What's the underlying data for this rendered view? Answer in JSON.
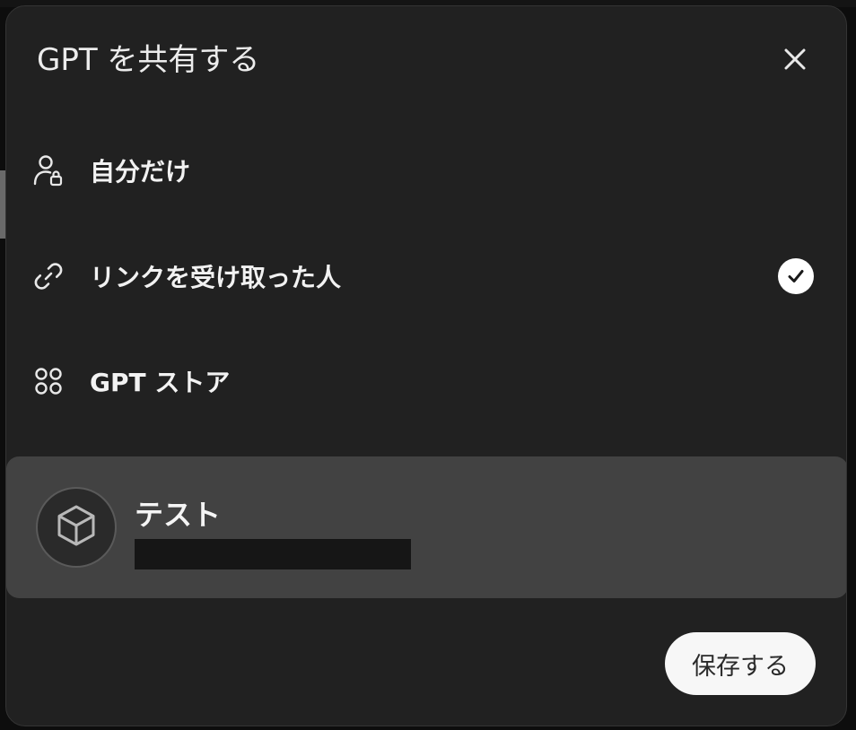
{
  "dialog": {
    "title": "GPT を共有する",
    "close_icon": "close-icon"
  },
  "share_options": [
    {
      "label": "自分だけ",
      "icon": "person-lock-icon",
      "selected": false
    },
    {
      "label": "リンクを受け取った人",
      "icon": "link-icon",
      "selected": true
    },
    {
      "label": "GPT ストア",
      "icon": "grid-icon",
      "selected": false
    }
  ],
  "gpt": {
    "name": "テスト",
    "icon": "cube-icon",
    "description_redacted": true
  },
  "actions": {
    "save_label": "保存する"
  },
  "colors": {
    "modal_bg": "#212121",
    "card_bg": "#424242",
    "text": "#ececec",
    "check_bg": "#ffffff",
    "save_bg": "#f7f7f7"
  }
}
